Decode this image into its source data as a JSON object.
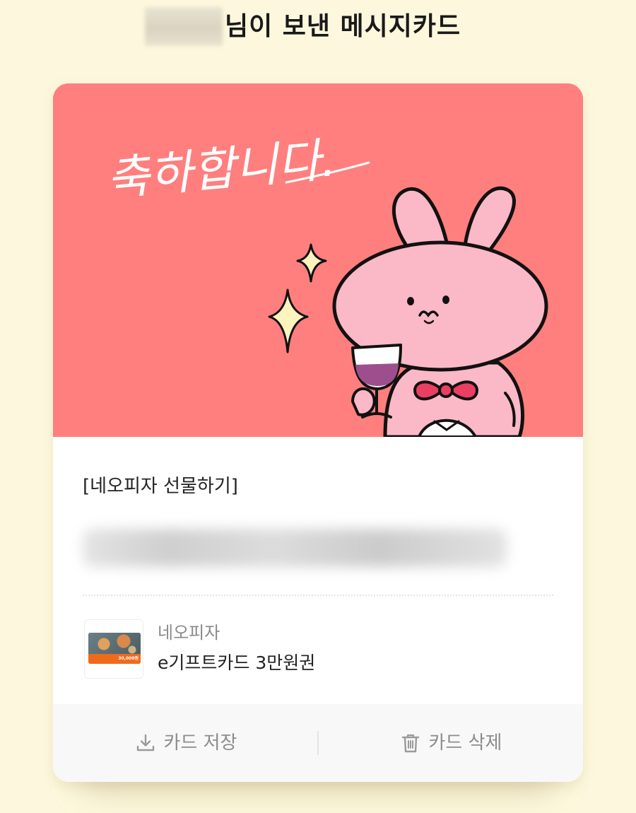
{
  "header": {
    "title_suffix": "님이 보낸 메시지카드"
  },
  "card": {
    "art_text": "축하합니다.",
    "colors": {
      "art_background": "#ff7f7e",
      "bunny_body": "#fbb8c6",
      "bow": "#ea3f62",
      "sparkle": "#fdf3bd",
      "page_background": "#fdf8dd"
    },
    "brand_tag": "[네오피자 선물하기]"
  },
  "product": {
    "brand": "네오피자",
    "name": "e기프트카드 3만원권",
    "thumbnail_price": "30,000원"
  },
  "actions": {
    "save_label": "카드 저장",
    "save_icon": "download-icon",
    "delete_label": "카드 삭제",
    "delete_icon": "trash-icon"
  }
}
